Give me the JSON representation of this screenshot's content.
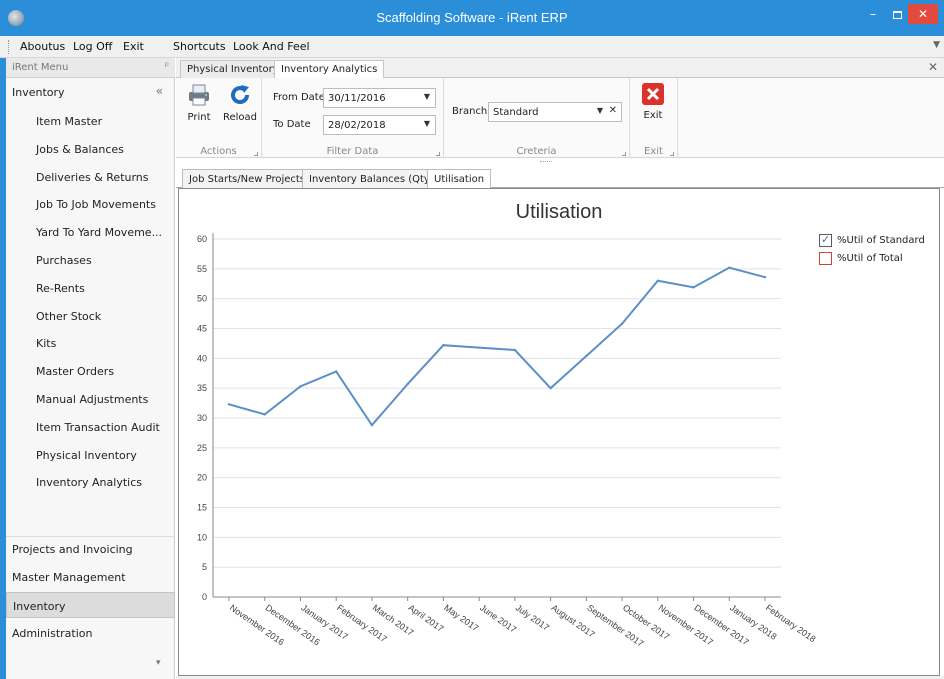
{
  "window": {
    "title": "Scaffolding Software - iRent ERP",
    "min": "–",
    "close": "✕"
  },
  "menubar": {
    "items": [
      "Aboutus",
      "Log Off",
      "Exit",
      "Shortcuts",
      "Look And Feel"
    ]
  },
  "sidebar": {
    "header": "iRent Menu",
    "pin": "ᵖ",
    "group": "Inventory",
    "group_chevron": "«",
    "items": [
      "Item Master",
      "Jobs & Balances",
      "Deliveries & Returns",
      "Job To Job Movements",
      "Yard To Yard Moveme...",
      "Purchases",
      "Re-Rents",
      "Other Stock",
      "Kits",
      "Master Orders",
      "Manual Adjustments",
      "Item Transaction Audit",
      "Physical Inventory",
      "Inventory Analytics"
    ],
    "bottom": [
      "Projects and Invoicing",
      "Master Management",
      "Inventory",
      "Administration"
    ],
    "active_bottom": "Inventory",
    "more": "▾"
  },
  "doctabs": {
    "tabs": [
      "Physical Inventory",
      "Inventory Analytics"
    ],
    "active": "Inventory Analytics",
    "close": "✕"
  },
  "ribbon": {
    "actions": {
      "print": "Print",
      "reload": "Reload",
      "label": "Actions"
    },
    "filter": {
      "from_label": "From Date",
      "from_value": "30/11/2016",
      "to_label": "To Date",
      "to_value": "28/02/2018",
      "label": "Filter Data"
    },
    "criteria": {
      "branch_label": "Branch",
      "branch_value": "Standard",
      "label": "Creteria"
    },
    "exit": {
      "button": "Exit",
      "label": "Exit"
    },
    "arrow": "▼",
    "clear": "✕"
  },
  "innertabs": {
    "tabs": [
      "Job Starts/New Projects",
      "Inventory Balances (Qty)",
      "Utilisation"
    ],
    "active": "Utilisation"
  },
  "chart_data": {
    "type": "line",
    "title": "Utilisation",
    "categories": [
      "November 2016",
      "December 2016",
      "January 2017",
      "February 2017",
      "March 2017",
      "April 2017",
      "May 2017",
      "June 2017",
      "July 2017",
      "August 2017",
      "September 2017",
      "October 2017",
      "November 2017",
      "December 2017",
      "January 2018",
      "February 2018"
    ],
    "series": [
      {
        "name": "%Util of Standard",
        "values": [
          32.3,
          30.6,
          35.3,
          37.8,
          28.8,
          35.7,
          42.2,
          41.8,
          41.4,
          35.0,
          40.4,
          45.8,
          53.0,
          51.9,
          55.2,
          53.6
        ],
        "color": "#5b8fc7",
        "visible": true
      },
      {
        "name": "%Util of Total",
        "values": [],
        "color": "#d04040",
        "visible": false
      }
    ],
    "ylim": [
      0,
      60
    ],
    "yticks": [
      0,
      5,
      10,
      15,
      20,
      25,
      30,
      35,
      40,
      45,
      50,
      55,
      60
    ],
    "grid": true,
    "legend": "top-right",
    "xlabel": "",
    "ylabel": ""
  },
  "colors": {
    "titlebar": "#2a8fd8",
    "close": "#e04a3f",
    "line": "#5b8fc7",
    "exit_icon": "#d9332b"
  },
  "icons": {
    "print": "printer-icon",
    "reload": "reload-icon",
    "exit": "exit-icon",
    "check": "✓"
  }
}
